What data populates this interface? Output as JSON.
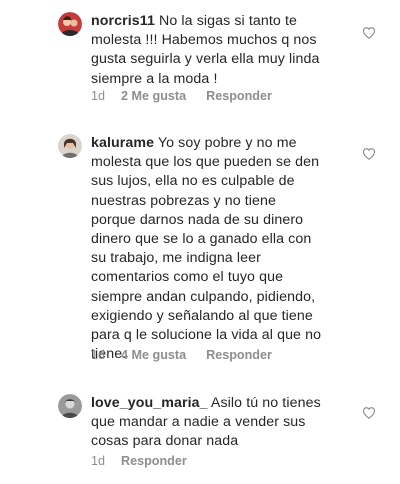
{
  "comments": [
    {
      "username": "norcris11",
      "text": " No la sigas si tanto te\nmolesta !!! Habemos muchos q nos\ngusta seguirla y verla ella muy linda\nsiempre a la moda !",
      "age": "1d",
      "likes": "2 Me gusta",
      "reply": "Responder"
    },
    {
      "username": "kalurame",
      "text": " Yo soy pobre y no me\nmolesta que los que pueden se den\nsus lujos, ella no es culpable de\nnuestras pobrezas y no tiene\nporque darnos nada de su dinero\ndinero que se lo a ganado ella con\nsu trabajo, me indigna leer\ncomentarios como el tuyo que\nsiempre andan culpando, pidiendo,\nexigiendo  y señalando al que tiene\npara q le solucione la vida al que no\ntiene.",
      "age": "1d",
      "likes": "4 Me gusta",
      "reply": "Responder"
    },
    {
      "username": "love_you_maria_",
      "text": " Asilo tú no tienes\nque mandar a nadie a vender sus\ncosas para donar nada",
      "age": "1d",
      "reply": "Responder"
    }
  ],
  "icons": {
    "avatar": "avatar-icon",
    "like": "heart-outline-icon"
  },
  "colors": {
    "text": "#262626",
    "secondary": "#8e8e8e"
  }
}
